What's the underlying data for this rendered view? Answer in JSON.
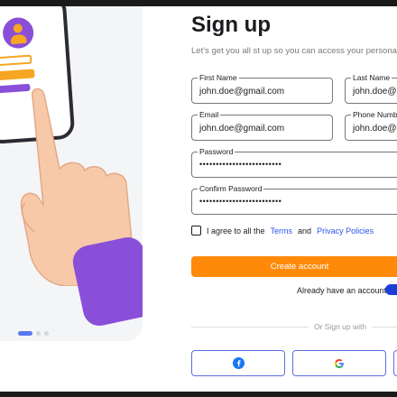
{
  "form": {
    "title": "Sign up",
    "subtitle": "Let’s get you all st up so you can access your personal a",
    "fields": {
      "first_name": {
        "label": "First Name",
        "value": "john.doe@gmail.com"
      },
      "last_name": {
        "label": "Last Name",
        "value": "john.doe@g"
      },
      "email": {
        "label": "Email",
        "value": "john.doe@gmail.com"
      },
      "phone": {
        "label": "Phone Numbe",
        "value": "john.doe@g"
      },
      "password": {
        "label": "Password",
        "value": "•••••••••••••••••••••••••"
      },
      "confirm_password": {
        "label": "Confirm Password",
        "value": "•••••••••••••••••••••••••"
      }
    },
    "agree": {
      "prefix": "I agree to all the",
      "terms": "Terms",
      "and": "and",
      "privacy": "Privacy Policies",
      "checked": false
    },
    "create_button": "Create account",
    "already_account": "Already have an account?",
    "or_signup_with": "Or Sign up with",
    "social": [
      "facebook-icon",
      "google-icon"
    ]
  },
  "carousel": {
    "slides": 3,
    "active_index": 0
  },
  "colors": {
    "accent": "#ff8a0a",
    "link": "#2f54eb",
    "purple": "#8a4fd9",
    "social_border": "#5a6fe0"
  }
}
